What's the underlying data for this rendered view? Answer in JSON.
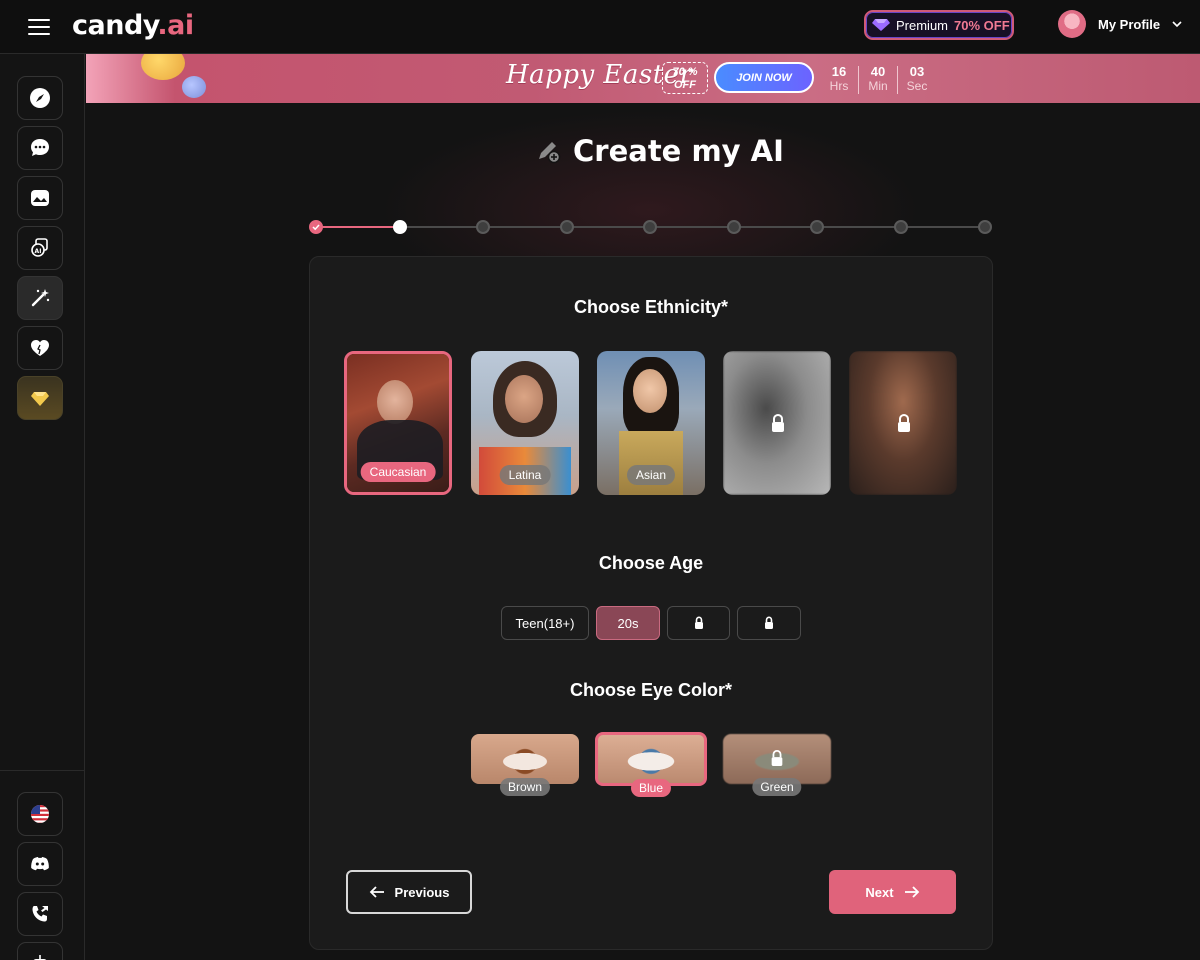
{
  "header": {
    "logo_main": "candy",
    "logo_dot": ".ai",
    "premium_label": "Premium",
    "premium_off": "70% OFF",
    "profile_label": "My Profile"
  },
  "banner": {
    "headline": "Happy Easter",
    "discount_pct": "70 %",
    "discount_off": "OFF",
    "cta": "JOIN NOW",
    "timer": [
      {
        "value": "16",
        "unit": "Hrs"
      },
      {
        "value": "40",
        "unit": "Min"
      },
      {
        "value": "03",
        "unit": "Sec"
      }
    ]
  },
  "page": {
    "title": "Create my AI",
    "current_step": 2,
    "total_steps": 9
  },
  "ethnicity": {
    "heading": "Choose Ethnicity*",
    "options": [
      {
        "label": "Caucasian",
        "selected": true,
        "locked": false
      },
      {
        "label": "Latina",
        "selected": false,
        "locked": false
      },
      {
        "label": "Asian",
        "selected": false,
        "locked": false
      },
      {
        "label": "",
        "selected": false,
        "locked": true
      },
      {
        "label": "",
        "selected": false,
        "locked": true
      }
    ]
  },
  "age": {
    "heading": "Choose Age",
    "options": [
      {
        "label": "Teen(18+)",
        "selected": false,
        "locked": false
      },
      {
        "label": "20s",
        "selected": true,
        "locked": false
      },
      {
        "label": "",
        "selected": false,
        "locked": true
      },
      {
        "label": "",
        "selected": false,
        "locked": true
      }
    ]
  },
  "eye_color": {
    "heading": "Choose Eye Color*",
    "options": [
      {
        "label": "Brown",
        "selected": false,
        "locked": false
      },
      {
        "label": "Blue",
        "selected": true,
        "locked": false
      },
      {
        "label": "Green",
        "selected": false,
        "locked": true
      }
    ]
  },
  "nav": {
    "previous": "Previous",
    "next": "Next"
  },
  "colors": {
    "accent": "#e8677f",
    "background": "#131313",
    "card": "#1b1b1b"
  },
  "sidebar_icons": [
    "compass-icon",
    "chat-icon",
    "gallery-icon",
    "ai-generate-icon",
    "magic-wand-icon",
    "heart-icon",
    "diamond-icon",
    "us-flag-icon",
    "discord-icon",
    "phone-icon",
    "robot-icon"
  ]
}
